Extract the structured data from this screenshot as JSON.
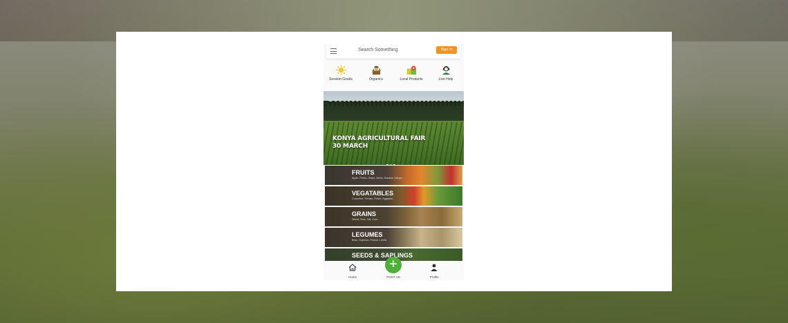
{
  "search": {
    "placeholder": "Search Something",
    "signin_label": "Sign In"
  },
  "categories": [
    {
      "label": "Session Goods",
      "icon": "sun-icon"
    },
    {
      "label": "Organics",
      "icon": "farmer-icon"
    },
    {
      "label": "Local Products",
      "icon": "local-products-icon"
    },
    {
      "label": "Live Help",
      "icon": "support-agent-icon"
    }
  ],
  "banner": {
    "line1": "KONYA AGRICULTURAL FAIR",
    "line2": "30 MARCH",
    "slide_count": 3,
    "active_slide": 1
  },
  "product_categories": [
    {
      "name": "FRUITS",
      "items": "Apple, Peach, Grape, Melon, Banana, Mango..."
    },
    {
      "name": "VEGATABLES",
      "items": "Cucumber, Tomato, Potato, Eggplant..."
    },
    {
      "name": "GRAINS",
      "items": "Wheat, Rice, Oat, Corn..."
    },
    {
      "name": "LEGUMES",
      "items": "Bean, Soybean, Peanut, Lentils"
    },
    {
      "name": "SEEDS & SAPLINGS",
      "items": ""
    }
  ],
  "bottom_nav": {
    "home": "Home",
    "post_ad": "POST AD",
    "profile": "Profile"
  },
  "colors": {
    "accent": "#f4931f",
    "fab": "#4fae3c"
  }
}
